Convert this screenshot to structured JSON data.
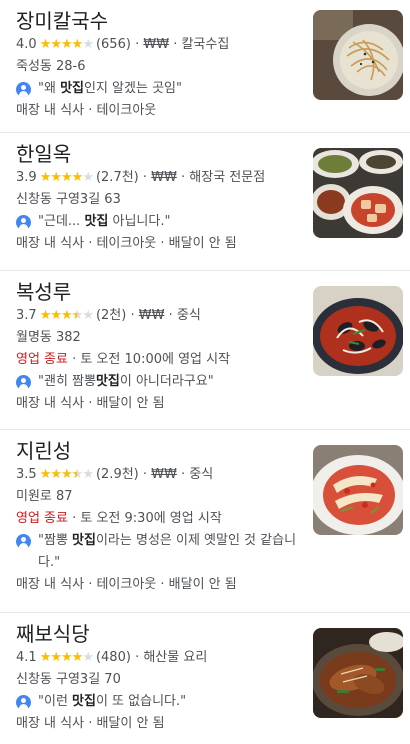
{
  "results": [
    {
      "name": "장미칼국수",
      "rating": "4.0",
      "stars": 4.0,
      "reviews": "(656)",
      "price": "₩₩",
      "category": "칼국수집",
      "address": "죽성동 28-6",
      "status": "",
      "status_detail": "",
      "quote_open": "\"왜 ",
      "quote_bold": "맛집",
      "quote_rest": "인지 알겠는 곳임\"",
      "services": "매장 내 식사 · 테이크아웃",
      "thumbnail": "noodle-soup"
    },
    {
      "name": "한일옥",
      "rating": "3.9",
      "stars": 4.0,
      "reviews": "(2.7천)",
      "price": "₩₩",
      "category": "해장국 전문점",
      "address": "신창동 구영3길 63",
      "status": "",
      "status_detail": "",
      "quote_open": "\"근데... ",
      "quote_bold": "맛집",
      "quote_rest": " 아닙니다.\"",
      "services": "매장 내 식사 · 테이크아웃 · 배달이 안 됨",
      "thumbnail": "side-dishes"
    },
    {
      "name": "복성루",
      "rating": "3.7",
      "stars": 3.5,
      "reviews": "(2천)",
      "price": "₩₩",
      "category": "중식",
      "address": "월명동 382",
      "status": "영업 종료",
      "status_detail": " · 토 오전 10:00에 영업 시작",
      "quote_open": "\"괜히 짬뽕",
      "quote_bold": "맛집",
      "quote_rest": "이 아니더라구요\"",
      "services": "매장 내 식사 · 배달이 안 됨",
      "thumbnail": "seafood-noodles"
    },
    {
      "name": "지린성",
      "rating": "3.5",
      "stars": 3.5,
      "reviews": "(2.9천)",
      "price": "₩₩",
      "category": "중식",
      "address": "미원로 87",
      "status": "영업 종료",
      "status_detail": " · 토 오전 9:30에 영업 시작",
      "quote_open": "\"짬뽕 ",
      "quote_bold": "맛집",
      "quote_rest": "이라는 명성은 이제 옛말인 것 같습니다.\"",
      "services": "매장 내 식사 · 테이크아웃 · 배달이 안 됨",
      "thumbnail": "kimchi"
    },
    {
      "name": "째보식당",
      "rating": "4.1",
      "stars": 4.0,
      "reviews": "(480)",
      "price": "",
      "category": "해산물 요리",
      "address": "신창동 구영3길 70",
      "status": "",
      "status_detail": "",
      "quote_open": "\"이런 ",
      "quote_bold": "맛집",
      "quote_rest": "이 또 없습니다.\"",
      "services": "매장 내 식사 · 배달이 안 됨",
      "thumbnail": "braised-fish"
    }
  ]
}
